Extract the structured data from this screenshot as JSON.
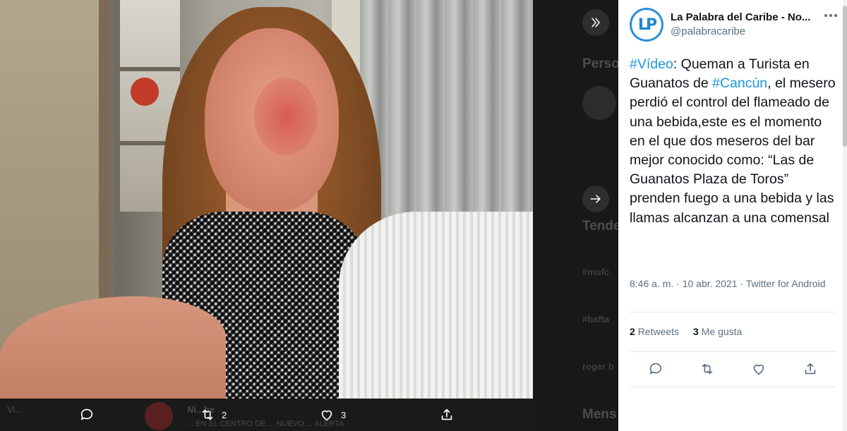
{
  "media": {
    "image_alt": "selfie photo of woman with burned face",
    "reply_count": "",
    "retweet_count": "2",
    "like_count": "3"
  },
  "background": {
    "ghost_headings": [
      "Perso",
      "Tende",
      "Mens"
    ],
    "ghost_trends": [
      "#mufc",
      "#bafta",
      "roger b"
    ],
    "ghost_left": "Vi...",
    "ghost_author": "Ni...be",
    "ghost_bottom_text": "... EN EL CENTRO DE ... NUEVO ... ALERTA"
  },
  "tweet": {
    "author_name": "La Palabra del Caribe - No...",
    "author_handle": "@palabracaribe",
    "avatar_logo": "LP",
    "text_parts": {
      "hashtag_video": "#Vídeo",
      "part1": ": Queman a Turista en Guanatos de ",
      "hashtag_cancun": "#Cancún",
      "part2": ", el mesero perdió el control del flameado de una bebida,este es el momento en el que dos meseros del bar mejor conocido como: “Las de Guanatos Plaza de Toros” prenden fuego a una bebida y las llamas alcanzan a una comensal"
    },
    "meta": "8:46 a. m. · 10 abr. 2021 · Twitter for Android",
    "retweets_count": "2",
    "retweets_label": "Retweets",
    "likes_count": "3",
    "likes_label": "Me gusta"
  },
  "colors": {
    "accent": "#1b95e0",
    "muted": "#5b7083",
    "text": "#0f1419"
  }
}
